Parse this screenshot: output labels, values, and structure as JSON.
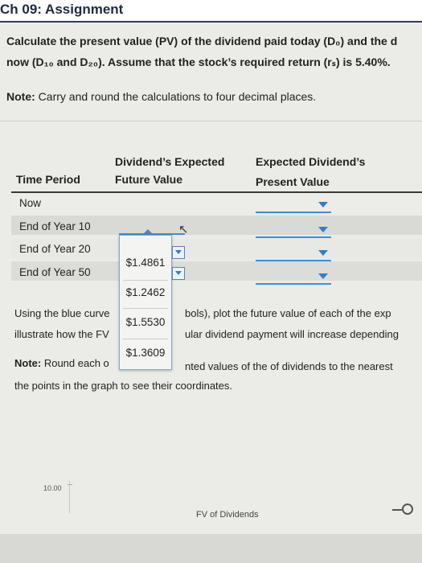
{
  "header": {
    "title": "Ch 09: Assignment"
  },
  "instructions": {
    "line1": "Calculate the present value (PV) of the dividend paid today (D₀) and the d",
    "line2": "now (D₁₀ and D₂₀). Assume that the stock’s required return (rₛ) is 5.40%.",
    "note_label": "Note:",
    "note_text": " Carry and round the calculations to four decimal places."
  },
  "table": {
    "col_time": "Time Period",
    "col_fv_line1": "Dividend’s Expected",
    "col_fv_line2": "Future Value",
    "col_pv_line1": "Expected Dividend’s",
    "col_pv_line2": "Present Value",
    "rows": [
      {
        "label": "Now"
      },
      {
        "label": "End of Year 10"
      },
      {
        "label": "End of Year 20"
      },
      {
        "label": "End of Year 50"
      }
    ]
  },
  "dropdown_popup": {
    "options": [
      "$1.4861",
      "$1.2462",
      "$1.5530",
      "$1.3609"
    ]
  },
  "graph_instructions": {
    "line1a": "Using the blue curve",
    "line1b": "bols), plot the future value of each of the exp",
    "line2a": "illustrate how the FV",
    "line2b": "ular dividend payment will increase depending",
    "line3a_label": "Note:",
    "line3a": " Round each o",
    "line3b": "nted values of the of dividends to the nearest",
    "line4": "the points in the graph to see their coordinates."
  },
  "graph": {
    "y_tick": "10.00",
    "legend_label": "FV of Dividends"
  },
  "colors": {
    "accent": "#3d8fd4",
    "header_rule": "#2c3e5a"
  }
}
